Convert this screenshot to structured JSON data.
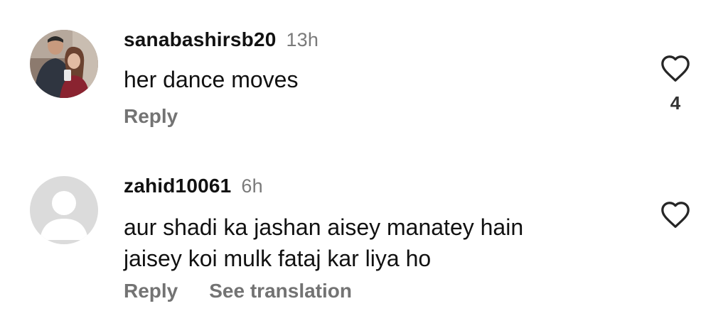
{
  "comments": [
    {
      "username": "sanabashirsb20",
      "time": "13h",
      "text_lines": [
        "her dance moves"
      ],
      "reply_label": "Reply",
      "like_count": "4",
      "avatar": "profile-photo-couple",
      "like_icon": "heart-outline-icon"
    },
    {
      "username": "zahid10061",
      "time": "6h",
      "text_lines": [
        "aur shadi ka jashan aisey manatey hain",
        "jaisey koi mulk fataj kar liya ho"
      ],
      "reply_label": "Reply",
      "translation_label": "See translation",
      "avatar": "default-profile-placeholder",
      "like_icon": "heart-outline-icon"
    }
  ],
  "colors": {
    "secondary_text": "#737373",
    "timestamp": "#7a7a7a",
    "icon_stroke": "#262626",
    "placeholder_bg": "#dbdbdb"
  }
}
